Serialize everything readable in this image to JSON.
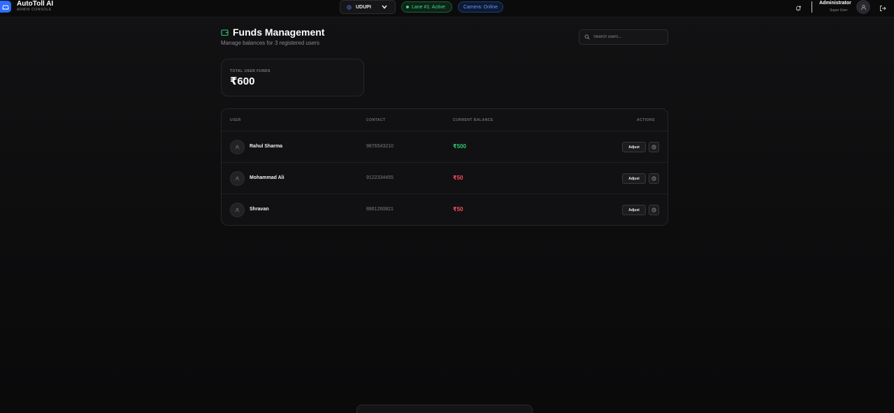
{
  "brand": {
    "title": "AutoToll AI",
    "subtitle": "ADMIN CONSOLE"
  },
  "header": {
    "location": "UDUPI",
    "lane_status": "Lane #1: Active",
    "camera_status": "Camera: Online",
    "user_name": "Administrator",
    "user_role": "Super User"
  },
  "page": {
    "title": "Funds Management",
    "subtitle": "Manage balances for 3 registered users",
    "search_placeholder": "Search users..."
  },
  "summary": {
    "label": "TOTAL USER FUNDS",
    "value": "₹600"
  },
  "table": {
    "columns": {
      "user": "USER",
      "contact": "CONTACT",
      "balance": "CURRENT BALANCE",
      "actions": "ACTIONS"
    },
    "rows": [
      {
        "name": "Rahul Sharma",
        "contact": "9876543210",
        "balance": "₹500",
        "balance_status": "positive",
        "action": "Adjust"
      },
      {
        "name": "Mohammad Ali",
        "contact": "9122334455",
        "balance": "₹50",
        "balance_status": "low",
        "action": "Adjust"
      },
      {
        "name": "Shravan",
        "contact": "8861260821",
        "balance": "₹50",
        "balance_status": "low",
        "action": "Adjust"
      }
    ]
  },
  "colors": {
    "accent": "#2f6bff",
    "positive": "#2ecc71",
    "low": "#ff4d5e",
    "active": "#3ddc84",
    "online": "#5b9bff"
  },
  "icons": [
    "car-icon",
    "location-icon",
    "chevron-down-icon",
    "bell-icon",
    "user-icon",
    "logout-icon",
    "wallet-icon",
    "search-icon",
    "history-icon"
  ]
}
